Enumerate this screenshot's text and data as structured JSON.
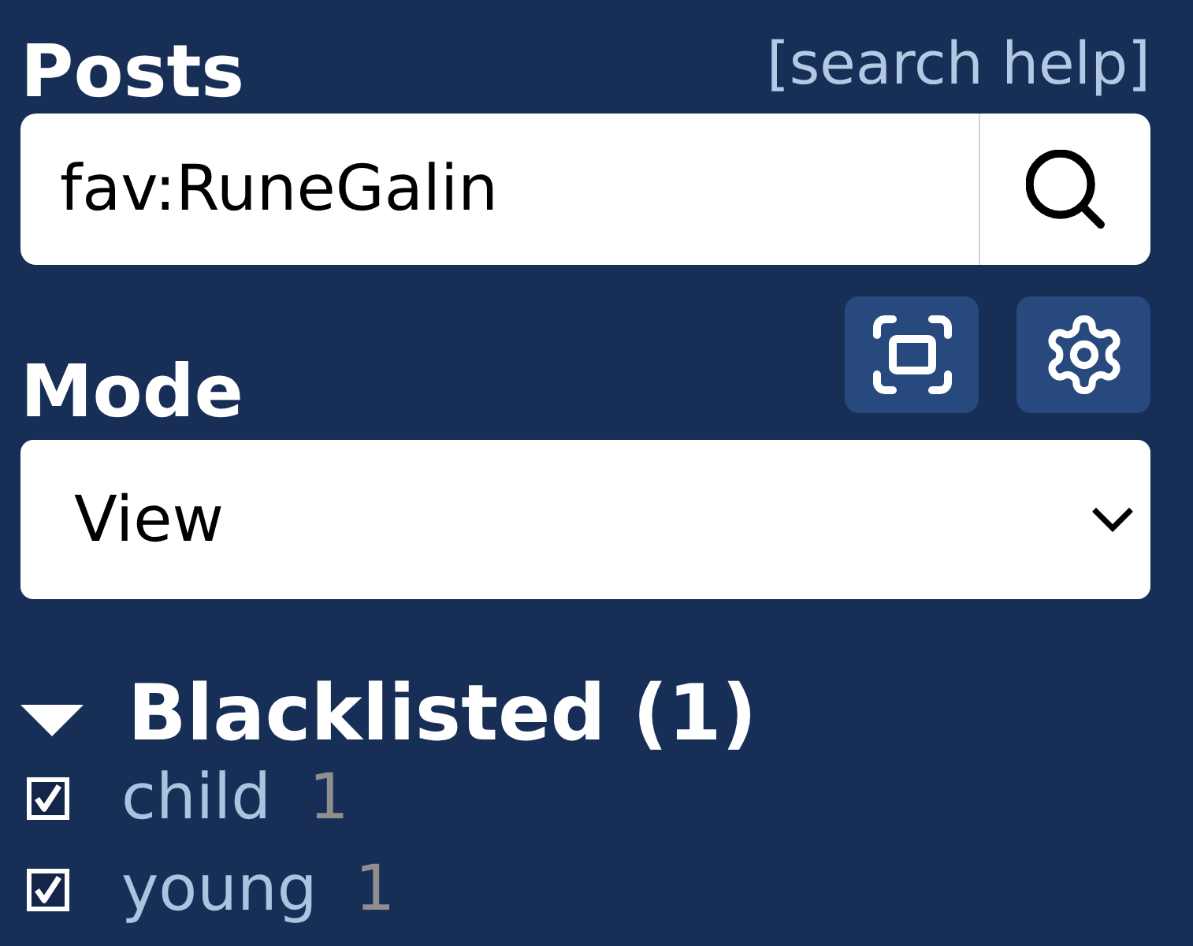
{
  "header": {
    "title": "Posts",
    "help_link": "[search help]"
  },
  "search": {
    "value": "fav:RuneGalin"
  },
  "mode": {
    "label": "Mode",
    "value": "View"
  },
  "blacklist": {
    "title": "Blacklisted (1)",
    "expanded": true,
    "items": [
      {
        "tag": "child",
        "count": "1",
        "checked": true
      },
      {
        "tag": "young",
        "count": "1",
        "checked": true
      }
    ]
  }
}
